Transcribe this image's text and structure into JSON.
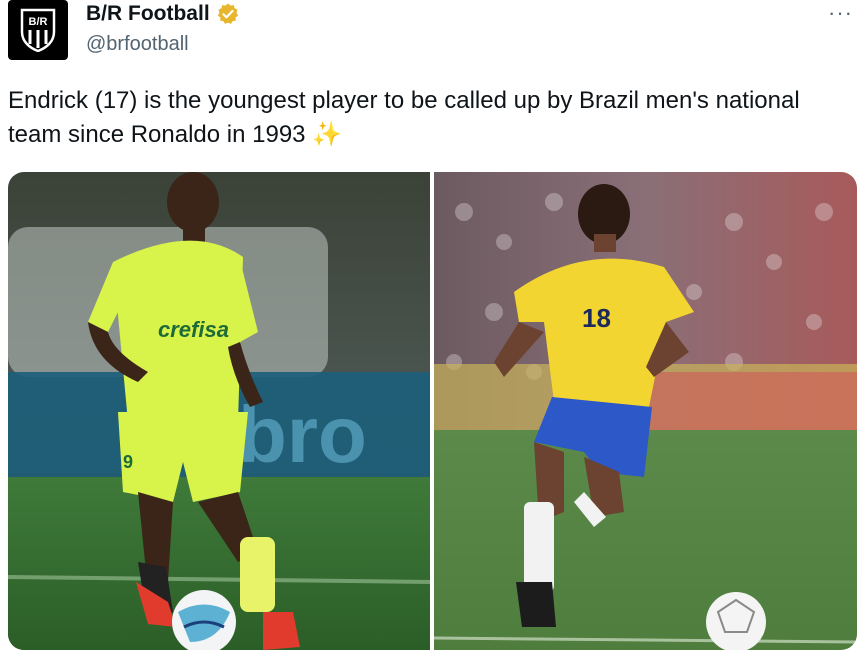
{
  "author": {
    "name": "B/R Football",
    "handle": "@brfootball",
    "avatar_text": "B/R",
    "verified": true,
    "verified_color": "#e8b62c"
  },
  "menu": {
    "more_label": "···"
  },
  "tweet": {
    "text": "Endrick (17) is the youngest player to be called up by Brazil men's national team since Ronaldo in 1993 ✨"
  },
  "media": {
    "left_photo": {
      "icon": "player-photo-icon",
      "shirt_color": "#d8f34a",
      "shirt_sponsor": "crefisa",
      "shirt_number": "9"
    },
    "right_photo": {
      "icon": "player-photo-icon",
      "shirt_color": "#f3d531",
      "shorts_color": "#2c58c8",
      "shirt_number": "18"
    }
  }
}
